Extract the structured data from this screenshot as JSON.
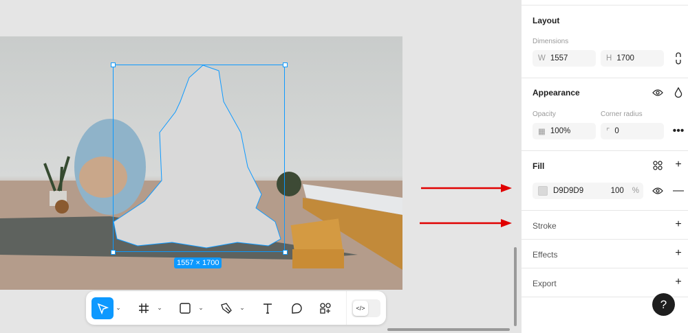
{
  "canvas": {
    "selection_size_label": "1557 × 1700"
  },
  "toolbar": {
    "tools": [
      "move",
      "frame",
      "shape",
      "pen",
      "text",
      "comment",
      "assets"
    ],
    "dev_mode_icon": "</>"
  },
  "panel": {
    "layout": {
      "title": "Layout",
      "dimensions_label": "Dimensions",
      "w_prefix": "W",
      "w_value": "1557",
      "h_prefix": "H",
      "h_value": "1700"
    },
    "appearance": {
      "title": "Appearance",
      "opacity_label": "Opacity",
      "opacity_value": "100%",
      "corner_label": "Corner radius",
      "corner_value": "0"
    },
    "fill": {
      "title": "Fill",
      "hex": "D9D9D9",
      "opacity": "100",
      "pct": "%",
      "swatch_color": "#D9D9D9"
    },
    "stroke": {
      "title": "Stroke"
    },
    "effects": {
      "title": "Effects"
    },
    "export": {
      "title": "Export"
    },
    "help": "?"
  },
  "colors": {
    "accent": "#0d99ff",
    "annotation": "#e00000"
  }
}
